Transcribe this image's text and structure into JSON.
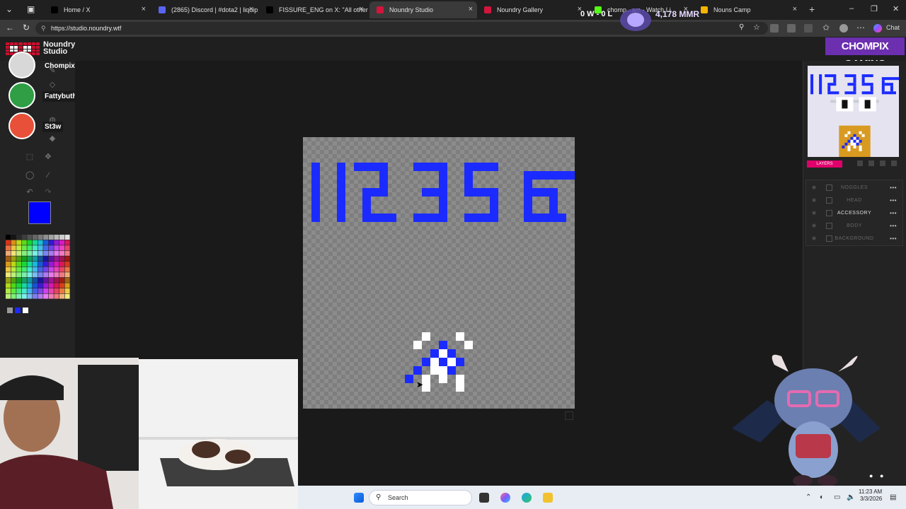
{
  "browser": {
    "tabs": [
      {
        "label": "Home / X",
        "color": "#000000"
      },
      {
        "label": "(2865) Discord | #dota2 | liquipe",
        "color": "#5865f2"
      },
      {
        "label": "FISSURE_ENG on X: \"All other Fi",
        "color": "#000000"
      },
      {
        "label": "Noundry Studio",
        "color": "#d2153d",
        "active": true
      },
      {
        "label": "Noundry Gallery",
        "color": "#d2153d"
      },
      {
        "label": "chomp...am - Watch Li",
        "color": "#53fc18"
      },
      {
        "label": "Nouns Camp",
        "color": "#f4b400"
      }
    ],
    "url": "https://studio.noundry.wtf",
    "new_tab_glyph": "+",
    "close_glyph": "×",
    "chat_label": "Chat"
  },
  "app": {
    "logo_line1": "Noundry",
    "logo_line2": "Studio"
  },
  "stream": {
    "banner": "CHOMPIX GAMING",
    "mmr": "4,178 MMR",
    "wl": "0 W - 0 L"
  },
  "users": [
    {
      "name": "Chompix",
      "color": "#d8d8d8"
    },
    {
      "name": "Fattybuthappy",
      "color": "#2f9e44"
    },
    {
      "name": "St3w",
      "color": "#e8503a"
    }
  ],
  "colors": {
    "selected": "#0000ff",
    "accent": "#e0006b",
    "canvas_fill": "#1b2bff"
  },
  "layers": {
    "tag": "LAYERS",
    "rows": [
      {
        "label": "NOGGLES",
        "active": false
      },
      {
        "label": "HEAD",
        "active": false
      },
      {
        "label": "ACCESSORY",
        "active": true
      },
      {
        "label": "BODY",
        "active": false
      },
      {
        "label": "BACKGROUND",
        "active": false
      }
    ]
  },
  "taskbar": {
    "search_placeholder": "Search",
    "time": "11:23 AM",
    "date": "3/3/2026"
  }
}
